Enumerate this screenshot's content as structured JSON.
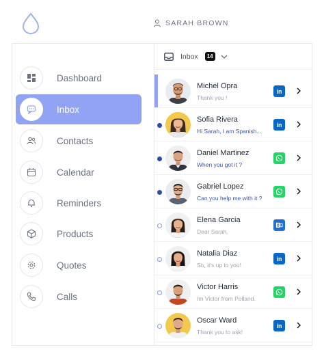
{
  "user": {
    "name": "SARAH BROWN"
  },
  "colors": {
    "accent": "#93a3f3",
    "unread": "#2d4aa8",
    "linkedin": "#0a66c2",
    "whatsapp": "#25d366",
    "outlook": "#1f6fd1"
  },
  "sidebar": {
    "items": [
      {
        "label": "Dashboard",
        "icon": "grid-icon"
      },
      {
        "label": "Inbox",
        "icon": "chat-icon",
        "active": true
      },
      {
        "label": "Contacts",
        "icon": "users-icon"
      },
      {
        "label": "Calendar",
        "icon": "calendar-icon"
      },
      {
        "label": "Reminders",
        "icon": "bell-icon"
      },
      {
        "label": "Products",
        "icon": "box-icon"
      },
      {
        "label": "Quotes",
        "icon": "gear-icon"
      },
      {
        "label": "Calls",
        "icon": "phone-icon"
      }
    ]
  },
  "inbox": {
    "title": "Inbox",
    "count": "14",
    "conversations": [
      {
        "name": "Michel Opra",
        "message": "Thank you !",
        "channel": "linkedin",
        "status": "selected"
      },
      {
        "name": "Sofia Rivera",
        "message": "Hi Sarah, I am Spanish...",
        "channel": "linkedin",
        "status": "unread"
      },
      {
        "name": "Daniel Martinez",
        "message": "When you got it ?",
        "channel": "whatsapp",
        "status": "unread"
      },
      {
        "name": "Gabriel Lopez",
        "message": "Can you help me with it ?",
        "channel": "whatsapp",
        "status": "unread"
      },
      {
        "name": "Elena Garcia",
        "message": "Dear Sarah,",
        "channel": "outlook",
        "status": "read"
      },
      {
        "name": "Natalia Diaz",
        "message": "So, it's up to you!",
        "channel": "linkedin",
        "status": "read"
      },
      {
        "name": "Victor Harris",
        "message": "Im Victor from Polland.",
        "channel": "whatsapp",
        "status": "read"
      },
      {
        "name": "Oscar Ward",
        "message": "Thank you to ask!",
        "channel": "linkedin",
        "status": "read"
      }
    ]
  }
}
